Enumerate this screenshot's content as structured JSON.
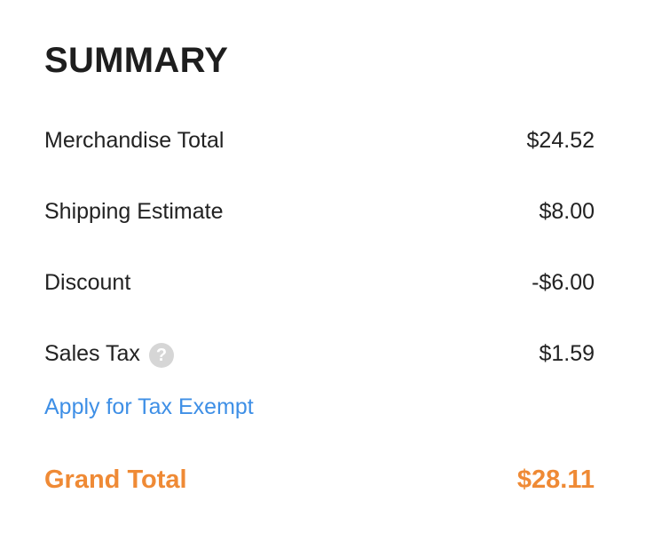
{
  "summary": {
    "title": "SUMMARY",
    "rows": [
      {
        "label": "Merchandise Total",
        "value": "$24.52"
      },
      {
        "label": "Shipping Estimate",
        "value": "$8.00"
      },
      {
        "label": "Discount",
        "value": "-$6.00"
      },
      {
        "label": "Sales Tax",
        "value": "$1.59",
        "icon": "question-mark-icon",
        "icon_glyph": "?"
      }
    ],
    "tax_exempt_link": "Apply for Tax Exempt",
    "grand_total": {
      "label": "Grand Total",
      "value": "$28.11"
    }
  },
  "colors": {
    "text": "#222222",
    "link": "#3e8fe6",
    "accent": "#ef8a35",
    "help_icon_bg": "#d6d6d6"
  }
}
